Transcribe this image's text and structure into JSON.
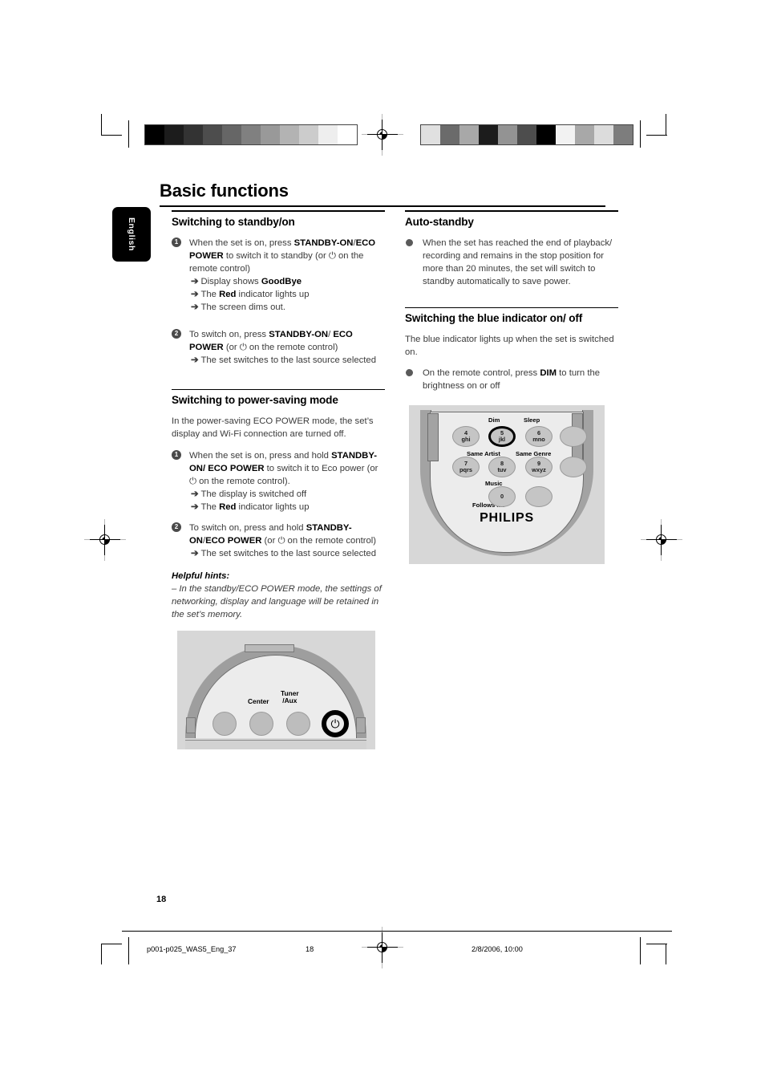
{
  "page": {
    "title": "Basic functions",
    "language_tab": "English",
    "page_number": "18"
  },
  "footer": {
    "file": "p001-p025_WAS5_Eng_37",
    "page": "18",
    "timestamp": "2/8/2006, 10:00"
  },
  "colorbars": {
    "left_label": "grayscale-step-wedge",
    "left": [
      "#000000",
      "#1c1c1c",
      "#333333",
      "#4d4d4d",
      "#666666",
      "#808080",
      "#999999",
      "#b3b3b3",
      "#cccccc",
      "#eeeeee",
      "#ffffff"
    ],
    "right": [
      "#e0e0e0",
      "#6b6b6b",
      "#a8a8a8",
      "#1c1c1c",
      "#939393",
      "#4d4d4d",
      "#000000",
      "#f2f2f2",
      "#a8a8a8",
      "#dcdcdc",
      "#7d7d7d"
    ]
  },
  "left_column": {
    "section1": {
      "heading": "Switching to standby/on",
      "steps": [
        {
          "num": "1",
          "text_parts": [
            {
              "t": "When the set is on, press ",
              "b": false
            },
            {
              "t": "STANDBY-ON",
              "b": true
            },
            {
              "t": "/",
              "b": false
            },
            {
              "t": "ECO POWER",
              "b": true
            },
            {
              "t": " to switch it to standby (or ⏻ on the remote control)",
              "b": false
            }
          ],
          "results": [
            [
              {
                "t": "Display shows ",
                "b": false
              },
              {
                "t": "GoodBye",
                "b": true
              }
            ],
            [
              {
                "t": "The ",
                "b": false
              },
              {
                "t": "Red",
                "b": true
              },
              {
                "t": " indicator lights up",
                "b": false
              }
            ],
            [
              {
                "t": "The screen dims out.",
                "b": false
              }
            ]
          ]
        },
        {
          "num": "2",
          "text_parts": [
            {
              "t": "To switch on, press ",
              "b": false
            },
            {
              "t": "STANDBY-ON",
              "b": true
            },
            {
              "t": "/ ",
              "b": false
            },
            {
              "t": "ECO POWER",
              "b": true
            },
            {
              "t": " (or ⏻ on the remote control)",
              "b": false
            }
          ],
          "results": [
            [
              {
                "t": "The set switches to the last source selected",
                "b": false
              }
            ]
          ]
        }
      ]
    },
    "section2": {
      "heading": "Switching to power-saving mode",
      "intro": "In the power-saving ECO POWER mode, the set’s display and Wi-Fi connection are turned off.",
      "steps": [
        {
          "num": "1",
          "text_parts": [
            {
              "t": "When the set is on, press and hold ",
              "b": false
            },
            {
              "t": "STANDBY-ON/ ECO POWER",
              "b": true
            },
            {
              "t": "  to switch it to Eco power (or ⏻ on the remote control).",
              "b": false
            }
          ],
          "results": [
            [
              {
                "t": "The display is switched off",
                "b": false
              }
            ],
            [
              {
                "t": "The ",
                "b": false
              },
              {
                "t": "Red",
                "b": true
              },
              {
                "t": " indicator lights up",
                "b": false
              }
            ]
          ]
        },
        {
          "num": "2",
          "text_parts": [
            {
              "t": "To switch on, press and hold  ",
              "b": false
            },
            {
              "t": "STANDBY-ON",
              "b": true
            },
            {
              "t": "/",
              "b": false
            },
            {
              "t": "ECO POWER",
              "b": true
            },
            {
              "t": " (or ⏻  on the remote control)",
              "b": false
            }
          ],
          "results": [
            [
              {
                "t": "The set switches to the last source selected",
                "b": false
              }
            ]
          ]
        }
      ],
      "hints_title": "Helpful hints:",
      "hints_text": "–   In the standby/ECO POWER mode, the settings of networking, display and language will be retained in the set’s memory."
    },
    "figure_unit": {
      "labels": [
        "Center",
        "Tuner\n/Aux"
      ],
      "power_icon": "power-icon",
      "button_count": 4
    }
  },
  "right_column": {
    "section1": {
      "heading": "Auto-standby",
      "bullets": [
        "When the set has reached the end of playback/ recording and remains in the stop position for more than 20 minutes, the set will switch to standby automatically to save power."
      ]
    },
    "section2": {
      "heading": "Switching the blue indicator on/ off",
      "intro": "The blue indicator lights up when the set is switched on.",
      "bullet_parts": [
        {
          "t": "On the remote control, press ",
          "b": false
        },
        {
          "t": "DIM",
          "b": true
        },
        {
          "t": " to turn the brightness on or off",
          "b": false
        }
      ]
    },
    "figure_remote": {
      "brand": "PHILIPS",
      "labels_top": [
        "Dim",
        "Sleep"
      ],
      "labels_mid": [
        "Same Artist",
        "Same Genre"
      ],
      "labels_low": [
        "Music"
      ],
      "labels_bottom": [
        "Follows Me"
      ],
      "keys": [
        {
          "digit": "4",
          "letters": "ghi",
          "highlighted": false
        },
        {
          "digit": "5",
          "letters": "jkl",
          "highlighted": true
        },
        {
          "digit": "6",
          "letters": "mno",
          "highlighted": false
        },
        {
          "digit": "",
          "letters": "",
          "highlighted": false
        },
        {
          "digit": "7",
          "letters": "pqrs",
          "highlighted": false
        },
        {
          "digit": "8",
          "letters": "tuv",
          "highlighted": false
        },
        {
          "digit": "9",
          "letters": "wxyz",
          "highlighted": false
        },
        {
          "digit": "",
          "letters": "",
          "highlighted": false
        },
        {
          "digit": "0",
          "letters": "",
          "highlighted": false
        },
        {
          "digit": "",
          "letters": "",
          "highlighted": false
        }
      ]
    }
  }
}
